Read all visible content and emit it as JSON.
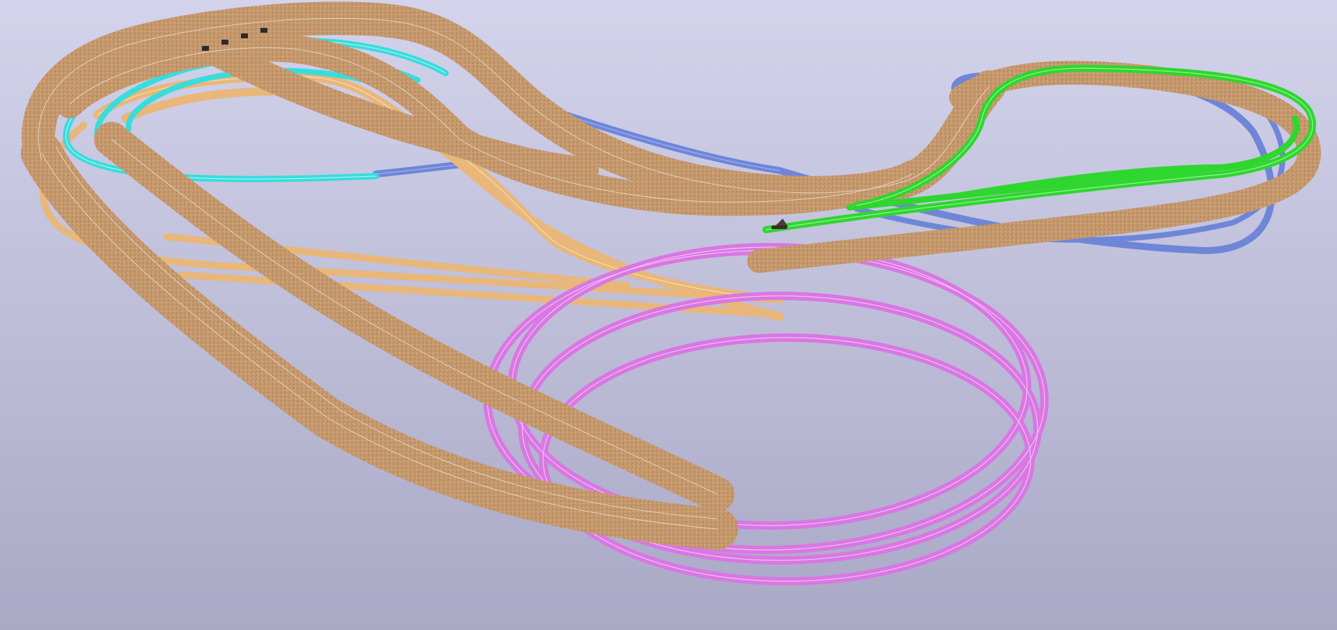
{
  "scene": {
    "background_top": "#d3d3ec",
    "background_bottom": "#a9a9c6"
  },
  "track_layers": {
    "blue_loop": {
      "color": "#6f86d8",
      "rail": "#9fb1ee"
    },
    "cyan_loop": {
      "color": "#39dcdc",
      "rail": "#a8f3f3"
    },
    "orange_lower": {
      "color": "#e8b779",
      "rail": "#f6dcb3"
    },
    "magenta_helix": {
      "color": "#d977e3",
      "rail": "#f0c1f4"
    },
    "green_upper": {
      "color": "#2fd62f",
      "rail": "#9cf29c"
    },
    "ballast_main": {
      "color": "#c79a6e",
      "rail": "#e4d4c4"
    }
  },
  "rolling_stock": {
    "buffer_stop_color": "#2b2b2b",
    "train_color": "#4a3b34"
  }
}
